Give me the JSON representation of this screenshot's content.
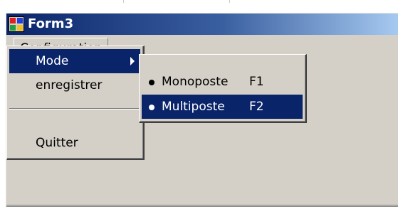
{
  "window": {
    "title": "Form3",
    "icon": "form-app-icon"
  },
  "menubar": {
    "configuration_label": "Configuration"
  },
  "menu": {
    "items": [
      {
        "label": "Mode",
        "has_submenu": true,
        "highlighted": true
      },
      {
        "label": "enregistrer"
      },
      {
        "label": "Quitter"
      }
    ]
  },
  "submenu": {
    "items": [
      {
        "label": "Monoposte",
        "shortcut": "F1",
        "checked": true,
        "highlighted": false
      },
      {
        "label": "Multiposte",
        "shortcut": "F2",
        "checked": true,
        "highlighted": true
      }
    ]
  },
  "colors": {
    "face": "#d4d0c8",
    "highlight": "#0a246a",
    "title_gradient_start": "#0a246a",
    "title_gradient_end": "#a6caf0"
  }
}
